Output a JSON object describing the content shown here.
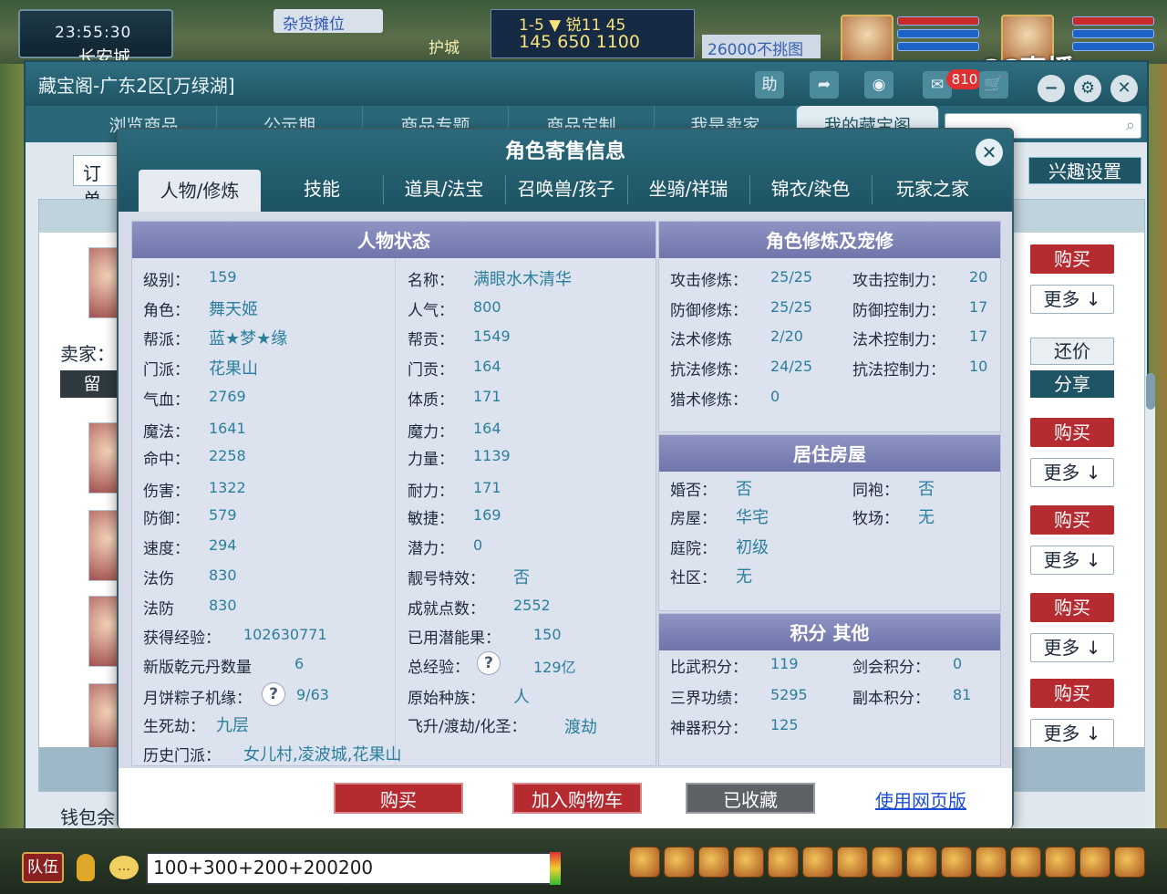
{
  "game": {
    "clock": "23:55:30",
    "city": "长安城",
    "stall_banner": "杂货摊位",
    "guard_banner": "护城",
    "stats_line1": "1-5 ▼ 锐11 45",
    "stats_line2": "145 650 1100",
    "banner_26000": "26000不挑图",
    "stream_logo": "CC直播",
    "team_button": "队伍",
    "chat_input_value": "100+300+200+200200"
  },
  "shop": {
    "title": "藏宝阁-广东2区[万绿湖]",
    "notif_count": "810",
    "nav_tabs": [
      "浏览商品",
      "公示期",
      "商品专题",
      "商品定制",
      "我是卖家",
      "我的藏宝阁"
    ],
    "order_tab": "订单",
    "interest_settings": "兴趣设置",
    "seller_label": "卖家：",
    "message_button": "留",
    "wallet_label": "钱包余",
    "buy_label": "购买",
    "more_label": "更多 ↓",
    "bargain_label": "还价",
    "share_label": "分享"
  },
  "modal": {
    "title": "角色寄售信息",
    "tabs": [
      "人物/修炼",
      "技能",
      "道具/法宝",
      "召唤兽/孩子",
      "坐骑/祥瑞",
      "锦衣/染色",
      "玩家之家"
    ],
    "status_head": "人物状态",
    "cultivation_head": "角色修炼及宠修",
    "house_head": "居住房屋",
    "points_head": "积分 其他",
    "left_col": [
      {
        "label": "级别：",
        "value": "159"
      },
      {
        "label": "角色：",
        "value": "舞天姬"
      },
      {
        "label": "帮派：",
        "value": "蓝★梦★缘"
      },
      {
        "label": "门派：",
        "value": "花果山"
      },
      {
        "label": "气血：",
        "value": "2769"
      },
      {
        "label": "魔法：",
        "value": "1641"
      },
      {
        "label": "命中：",
        "value": "2258"
      },
      {
        "label": "伤害：",
        "value": "1322"
      },
      {
        "label": "防御：",
        "value": "579"
      },
      {
        "label": "速度：",
        "value": "294"
      },
      {
        "label": "法伤",
        "value": "830"
      },
      {
        "label": "法防",
        "value": "830"
      }
    ],
    "right_col": [
      {
        "label": "名称：",
        "value": "满眼水木清华"
      },
      {
        "label": "人气：",
        "value": "800"
      },
      {
        "label": "帮贡：",
        "value": "1549"
      },
      {
        "label": "门贡：",
        "value": "164"
      },
      {
        "label": "体质：",
        "value": "171"
      },
      {
        "label": "魔力：",
        "value": "164"
      },
      {
        "label": "力量：",
        "value": "1139"
      },
      {
        "label": "耐力：",
        "value": "171"
      },
      {
        "label": "敏捷：",
        "value": "169"
      },
      {
        "label": "潜力：",
        "value": "0"
      },
      {
        "label": "靓号特效：",
        "value": "否"
      },
      {
        "label": "成就点数：",
        "value": "2552"
      }
    ],
    "extra": {
      "exp_label": "获得经验：",
      "exp_value": "102630771",
      "pills_label": "新版乾元丹数量",
      "pills_value": "6",
      "mooncake_label": "月饼粽子机缘：",
      "mooncake_value": "9/63",
      "life_label": "生死劫：",
      "life_value": "九层",
      "history_label": "历史门派：",
      "history_value": "女儿村,凌波城,花果山",
      "fruit_label": "已用潜能果：",
      "fruit_value": "150",
      "total_exp_label": "总经验：",
      "total_exp_value": "129亿",
      "race_label": "原始种族：",
      "race_value": "人",
      "ascend_label": "飞升/渡劫/化圣：",
      "ascend_value": "渡劫",
      "qmark": "?"
    },
    "cultivation": [
      {
        "label": "攻击修炼：",
        "value": "25/25",
        "label2": "攻击控制力：",
        "value2": "20"
      },
      {
        "label": "防御修炼：",
        "value": "25/25",
        "label2": "防御控制力：",
        "value2": "17"
      },
      {
        "label": "法术修炼",
        "value": "2/20",
        "label2": "法术控制力：",
        "value2": "17"
      },
      {
        "label": "抗法修炼：",
        "value": "24/25",
        "label2": "抗法控制力：",
        "value2": "10"
      },
      {
        "label": "猎术修炼：",
        "value": "0",
        "label2": "",
        "value2": ""
      }
    ],
    "house": [
      {
        "label": "婚否：",
        "value": "否",
        "label2": "同袍：",
        "value2": "否"
      },
      {
        "label": "房屋：",
        "value": "华宅",
        "label2": "牧场：",
        "value2": "无"
      },
      {
        "label": "庭院：",
        "value": "初级",
        "label2": "",
        "value2": ""
      },
      {
        "label": "社区：",
        "value": "无",
        "label2": "",
        "value2": ""
      }
    ],
    "points": [
      {
        "label": "比武积分：",
        "value": "119",
        "label2": "剑会积分：",
        "value2": "0"
      },
      {
        "label": "三界功绩：",
        "value": "5295",
        "label2": "副本积分：",
        "value2": "81"
      },
      {
        "label": "神器积分：",
        "value": "125",
        "label2": "",
        "value2": ""
      }
    ],
    "buttons": {
      "buy": "购买",
      "cart": "加入购物车",
      "favorited": "已收藏",
      "web": "使用网页版"
    }
  }
}
